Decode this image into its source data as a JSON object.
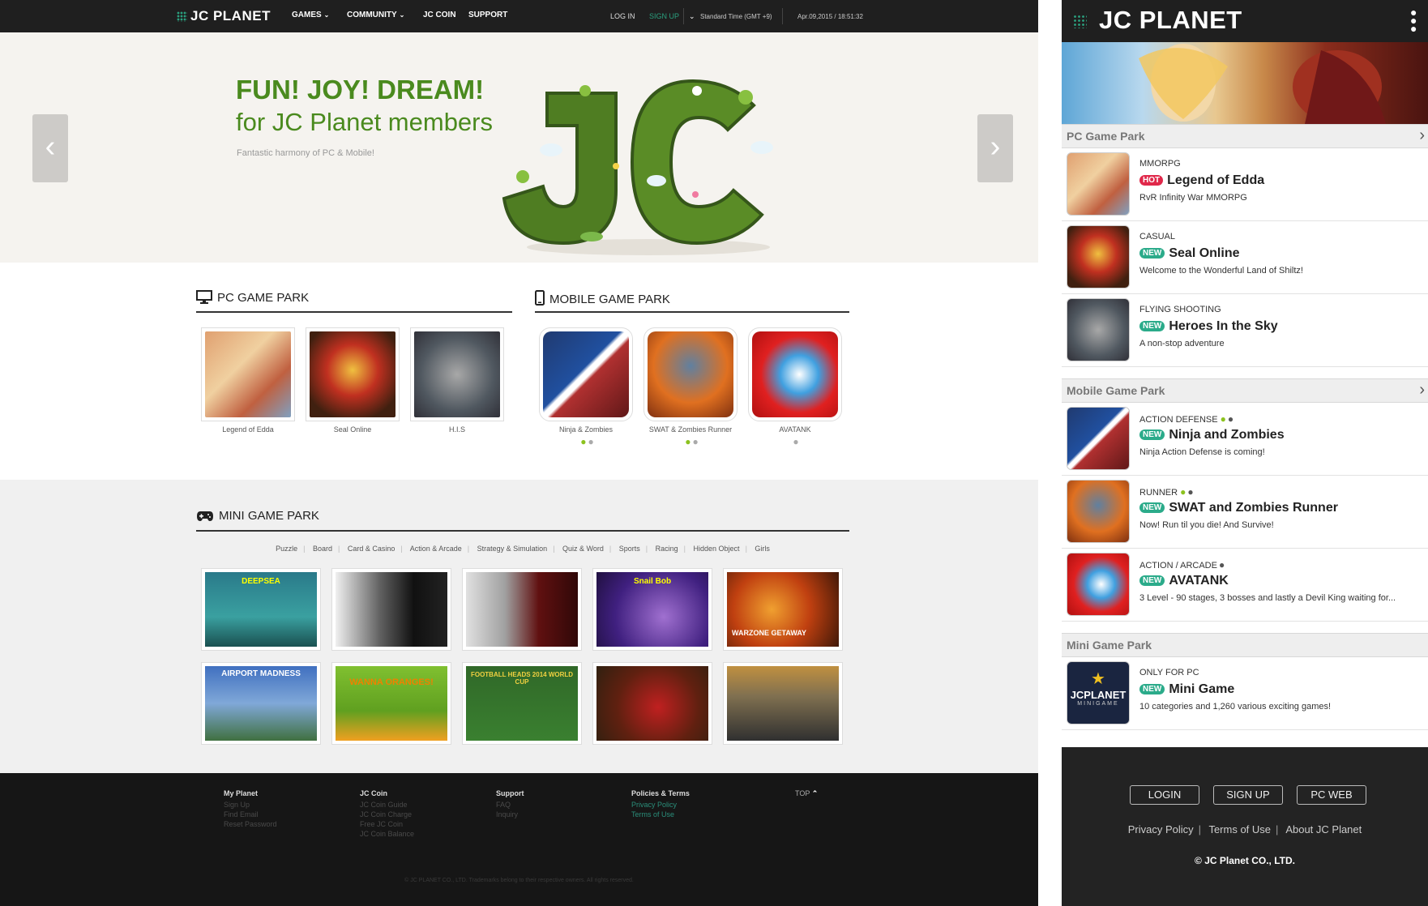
{
  "brand": {
    "name": "JC PLANET",
    "accent": "#2aa07e",
    "green": "#4a8a1e"
  },
  "desktop": {
    "nav": [
      "GAMES",
      "COMMUNITY",
      "JC COIN",
      "SUPPORT"
    ],
    "auth": {
      "login": "LOG IN",
      "signup": "SIGN UP"
    },
    "timezone": "Standard Time (GMT +9)",
    "datetime": "Apr.09,2015 / 18:51:32",
    "hero": {
      "line1": "FUN! JOY! DREAM!",
      "line2": "for JC Planet members",
      "line3": "Fantastic harmony of PC & Mobile!",
      "prev_icon": "chevron-left-icon",
      "next_icon": "chevron-right-icon"
    },
    "pc_park": {
      "title": "PC GAME PARK",
      "icon": "monitor-icon",
      "games": [
        {
          "name": "Legend of Edda"
        },
        {
          "name": "Seal Online"
        },
        {
          "name": "H.I.S"
        }
      ]
    },
    "mobile_park": {
      "title": "MOBILE GAME PARK",
      "icon": "smartphone-icon",
      "games": [
        {
          "name": "Ninja & Zombies",
          "platforms": "android-icon apple-icon"
        },
        {
          "name": "SWAT & Zombies Runner",
          "platforms": "android-icon apple-icon"
        },
        {
          "name": "AVATANK",
          "platforms": "apple-icon"
        }
      ]
    },
    "mini_park": {
      "title": "MINI GAME PARK",
      "icon": "gamepad-icon",
      "categories": [
        "Puzzle",
        "Board",
        "Card & Casino",
        "Action & Arcade",
        "Strategy & Simulation",
        "Quiz & Word",
        "Sports",
        "Racing",
        "Hidden Object",
        "Girls"
      ],
      "tiles": [
        {
          "caption": "DEEPSEA"
        },
        {
          "caption": ""
        },
        {
          "caption": ""
        },
        {
          "caption": "Snail Bob"
        },
        {
          "caption": "WARZONE GETAWAY"
        },
        {
          "caption": "AIRPORT MADNESS"
        },
        {
          "caption": "WANNA ORANGES!"
        },
        {
          "caption": "FOOTBALL HEADS 2014 WORLD CUP"
        },
        {
          "caption": ""
        },
        {
          "caption": ""
        }
      ]
    },
    "footer": {
      "cols": [
        {
          "head": "My Planet",
          "links": [
            "Sign Up",
            "Find Email",
            "Reset Password"
          ]
        },
        {
          "head": "JC Coin",
          "links": [
            "JC Coin Guide",
            "JC Coin Charge",
            "Free JC Coin",
            "JC Coin Balance"
          ]
        },
        {
          "head": "Support",
          "links": [
            "FAQ",
            "Inquiry"
          ]
        },
        {
          "head": "Policies & Terms",
          "links": [
            "Privacy Policy",
            "Terms of Use"
          ]
        }
      ],
      "top": "TOP",
      "copyright": "© JC PLANET CO., LTD. Trademarks belong to their respective owners. All rights reserved."
    }
  },
  "mobile": {
    "sections": [
      {
        "title": "PC Game Park",
        "has_chevron": true
      },
      {
        "title": "Mobile Game Park",
        "has_chevron": true
      },
      {
        "title": "Mini Game Park",
        "has_chevron": false
      }
    ],
    "pc_items": [
      {
        "category": "MMORPG",
        "badge": "HOT",
        "title": "Legend of Edda",
        "desc": "RvR Infinity War MMORPG"
      },
      {
        "category": "CASUAL",
        "badge": "NEW",
        "title": "Seal Online",
        "desc": "Welcome to the Wonderful Land of Shiltz!"
      },
      {
        "category": "FLYING SHOOTING",
        "badge": "NEW",
        "title": "Heroes In the Sky",
        "desc": "A non-stop adventure"
      }
    ],
    "mobile_items": [
      {
        "category": "ACTION DEFENSE",
        "badge": "NEW",
        "title": "Ninja and Zombies",
        "desc": "Ninja Action Defense is coming!",
        "platforms": "android-icon apple-icon"
      },
      {
        "category": "RUNNER",
        "badge": "NEW",
        "title": "SWAT and Zombies Runner",
        "desc": "Now! Run til you die! And Survive!",
        "platforms": "android-icon apple-icon"
      },
      {
        "category": "ACTION / ARCADE",
        "badge": "NEW",
        "title": "AVATANK",
        "desc": "3 Level - 90 stages, 3 bosses and lastly a Devil King waiting for...",
        "platforms": "apple-icon"
      }
    ],
    "mini_items": [
      {
        "category": "ONLY FOR PC",
        "badge": "NEW",
        "title": "Mini Game",
        "desc": "10 categories and 1,260 various exciting games!",
        "icon_text": "JCPLANET",
        "icon_sub": "MINIGAME"
      }
    ],
    "footer": {
      "buttons": [
        "LOGIN",
        "SIGN UP",
        "PC WEB"
      ],
      "links": [
        "Privacy Policy",
        "Terms of Use",
        "About JC Planet"
      ],
      "copyright": "© JC Planet CO., LTD."
    }
  }
}
